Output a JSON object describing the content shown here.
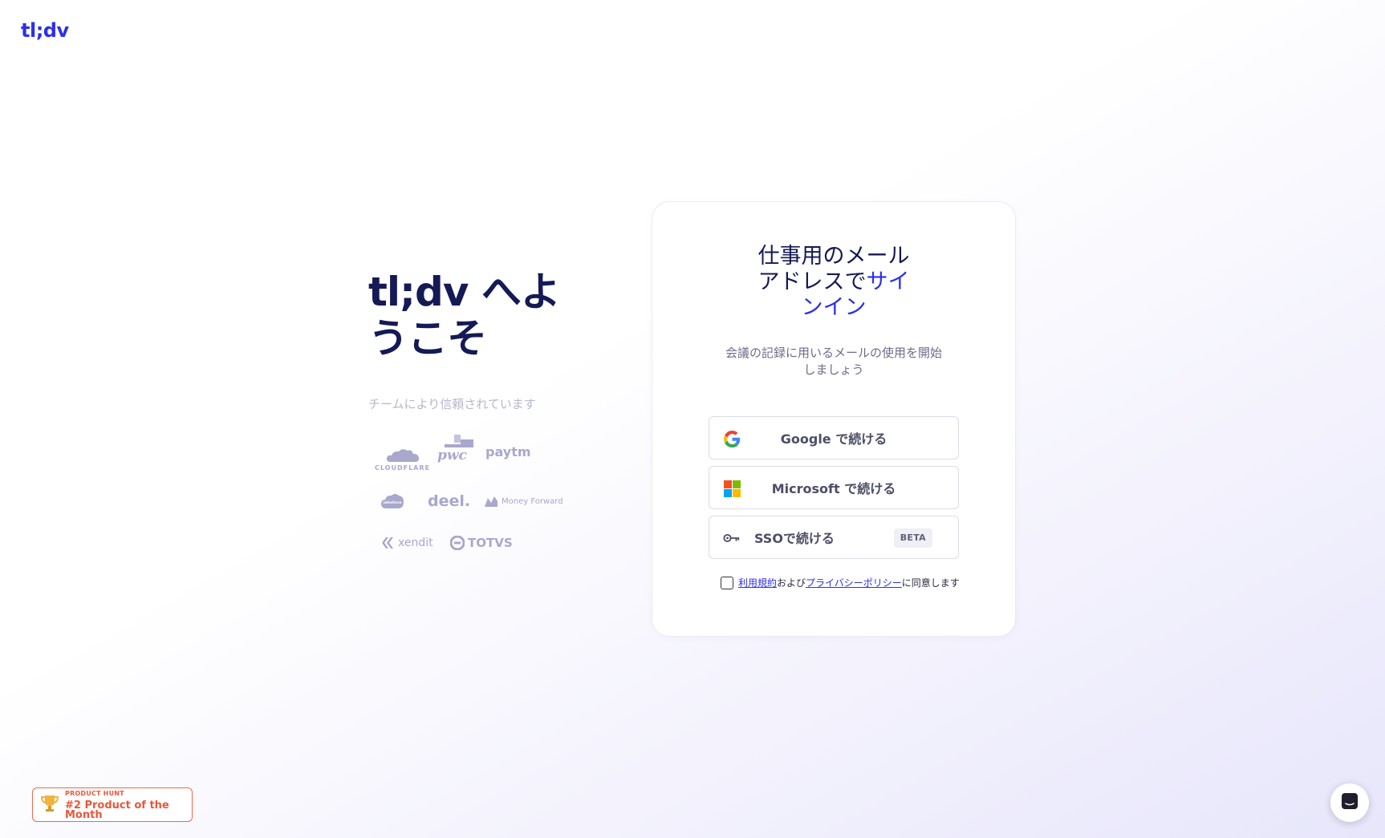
{
  "header": {
    "logo": "tl;dv"
  },
  "welcome": {
    "title_line1": "tl;dv へよ",
    "title_line2": "うこそ",
    "trusted_text": "チームにより信頼されています"
  },
  "brands": {
    "cloudflare": "CLOUDFLARE",
    "pwc": "pwc",
    "paytm": "paytm",
    "salesforce": "salesforce",
    "deel": "deel.",
    "moneyforward": "Money Forward",
    "xendit": "xendit",
    "totvs": "TOTVS"
  },
  "card": {
    "title_line1": "仕事用のメール",
    "title_line2_a": "アドレスで",
    "title_line2_b": "サイ",
    "title_line3": "ンイン",
    "subtitle_line1": "会議の記録に用いるメールの使用を開始",
    "subtitle_line2": "しましょう",
    "google_label": "Google で続ける",
    "microsoft_label": "Microsoft で続ける",
    "sso_label": "SSOで続ける",
    "beta_badge": "BETA",
    "terms_link": "利用規約",
    "terms_and": "および",
    "privacy_link": "プライバシーポリシー",
    "terms_agree": "に同意します"
  },
  "product_hunt": {
    "small": "PRODUCT HUNT",
    "big": "#2 Product of the Month"
  },
  "colors": {
    "accent": "#2b2ff0",
    "heading": "#141a55",
    "product_hunt": "#e8573a"
  }
}
